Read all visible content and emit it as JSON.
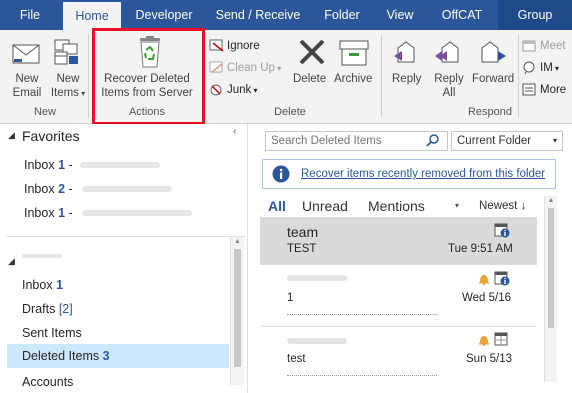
{
  "tabs": [
    {
      "label": "File",
      "active": false
    },
    {
      "label": "Home",
      "active": true
    },
    {
      "label": "Developer",
      "active": false
    },
    {
      "label": "Send / Receive",
      "active": false
    },
    {
      "label": "Folder",
      "active": false
    },
    {
      "label": "View",
      "active": false
    },
    {
      "label": "OffCAT",
      "active": false
    },
    {
      "label": "Group",
      "active": false
    }
  ],
  "ribbon": {
    "new_email_l1": "New",
    "new_email_l2": "Email",
    "new_items_l1": "New",
    "new_items_l2": "Items",
    "group_new": "New",
    "recover_l1": "Recover Deleted",
    "recover_l2": "Items from Server",
    "group_actions": "Actions",
    "ignore": "Ignore",
    "cleanup": "Clean Up",
    "junk": "Junk",
    "delete": "Delete",
    "archive": "Archive",
    "group_delete": "Delete",
    "reply": "Reply",
    "reply_all_l1": "Reply",
    "reply_all_l2": "All",
    "forward": "Forward",
    "meeting": "Meet",
    "im": "IM",
    "more": "More",
    "group_respond": "Respond"
  },
  "nav": {
    "favorites": "Favorites",
    "fav_items": [
      {
        "label": "Inbox",
        "count": "1"
      },
      {
        "label": "Inbox",
        "count": "2"
      },
      {
        "label": "Inbox",
        "count": "1"
      }
    ],
    "folders": [
      {
        "label": "Inbox",
        "count": "1"
      },
      {
        "label": "Drafts",
        "count": "[2]"
      },
      {
        "label": "Sent Items",
        "count": ""
      },
      {
        "label": "Deleted Items",
        "count": "3"
      },
      {
        "label": "Accounts",
        "count": ""
      }
    ]
  },
  "list": {
    "search_placeholder": "Search Deleted Items",
    "scope": "Current Folder",
    "info_link": "Recover items recently removed from this folder",
    "filters": [
      "All",
      "Unread",
      "Mentions"
    ],
    "sort": "Newest",
    "messages": [
      {
        "sender": "team",
        "subject": "TEST",
        "date": "Tue 9:51 AM",
        "selected": true
      },
      {
        "sender": "",
        "subject": "1",
        "date": "Wed 5/16",
        "selected": false
      },
      {
        "sender": "",
        "subject": "test",
        "date": "Sun 5/13",
        "selected": false
      }
    ]
  },
  "colors": {
    "accent": "#2b579a",
    "highlight": "#cce8ff",
    "selected": "#dadada",
    "callout": "#e81123"
  }
}
